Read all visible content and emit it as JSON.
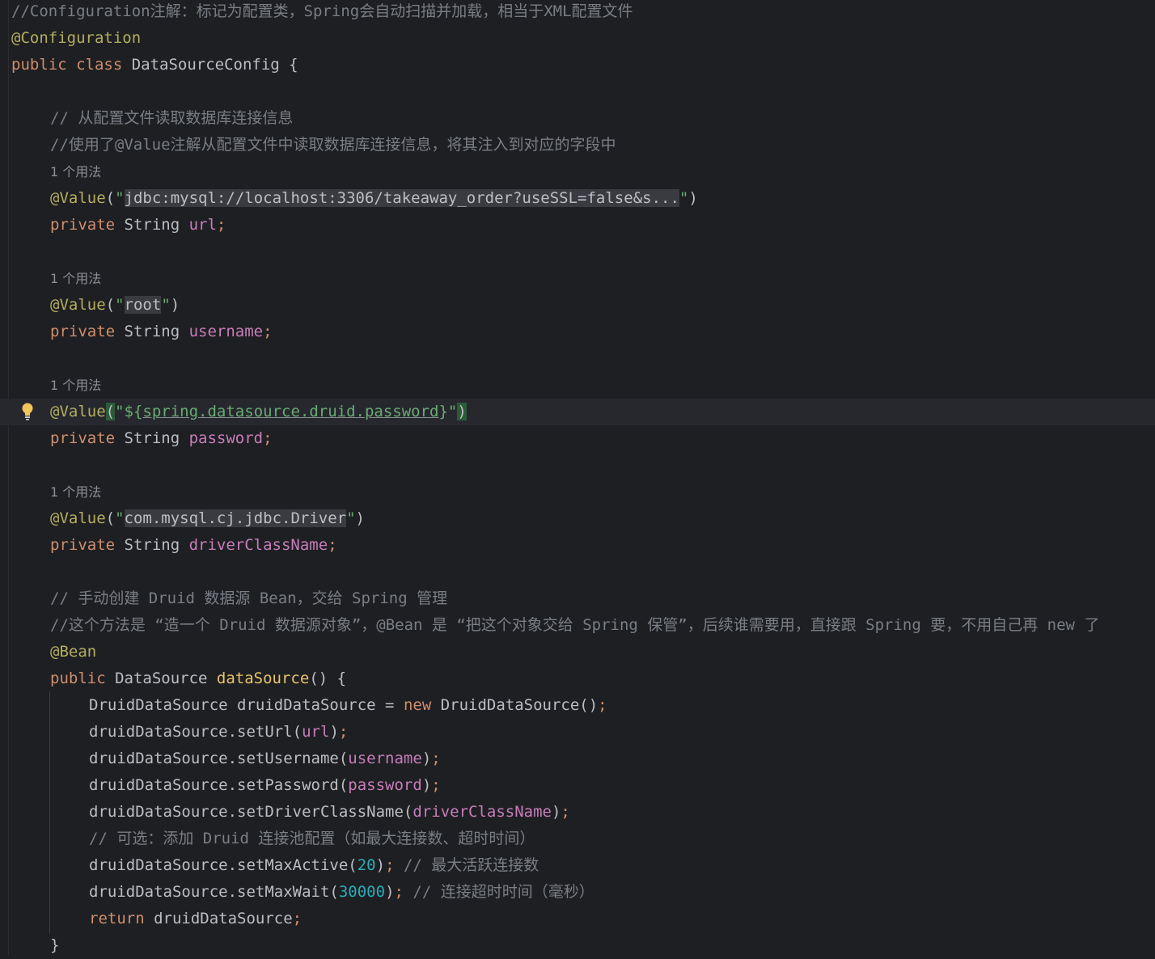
{
  "editor": {
    "lines": [
      {
        "indent": 0,
        "tokens": [
          {
            "t": "//Configuration注解：标记为配置类，Spring会自动扫描并加载，相当于XML配置文件",
            "c": "cmt"
          }
        ]
      },
      {
        "indent": 0,
        "tokens": [
          {
            "t": "@Configuration",
            "c": "ann"
          }
        ]
      },
      {
        "indent": 0,
        "tokens": [
          {
            "t": "public class ",
            "c": "kw"
          },
          {
            "t": "DataSourceConfig {",
            "c": "plain"
          }
        ]
      },
      {
        "indent": 0,
        "tokens": []
      },
      {
        "indent": 1,
        "tokens": [
          {
            "t": "// 从配置文件读取数据库连接信息",
            "c": "cmt"
          }
        ]
      },
      {
        "indent": 1,
        "tokens": [
          {
            "t": "//使用了@Value注解从配置文件中读取数据库连接信息，将其注入到对应的字段中",
            "c": "cmt"
          }
        ]
      },
      {
        "indent": 1,
        "hint": true,
        "tokens": [
          {
            "t": "1 个用法",
            "c": "hint"
          }
        ]
      },
      {
        "indent": 1,
        "tokens": [
          {
            "t": "@Value",
            "c": "ann"
          },
          {
            "t": "(",
            "c": "plain"
          },
          {
            "t": "\"",
            "c": "str"
          },
          {
            "t": "jdbc:mysql://localhost:3306/takeaway_order?useSSL=false&s...",
            "c": "strhl"
          },
          {
            "t": "\"",
            "c": "str"
          },
          {
            "t": ")",
            "c": "plain"
          }
        ]
      },
      {
        "indent": 1,
        "tokens": [
          {
            "t": "private ",
            "c": "kw"
          },
          {
            "t": "String ",
            "c": "plain"
          },
          {
            "t": "url",
            "c": "fld"
          },
          {
            "t": ";",
            "c": "kw"
          }
        ]
      },
      {
        "indent": 0,
        "tokens": []
      },
      {
        "indent": 1,
        "hint": true,
        "tokens": [
          {
            "t": "1 个用法",
            "c": "hint"
          }
        ]
      },
      {
        "indent": 1,
        "tokens": [
          {
            "t": "@Value",
            "c": "ann"
          },
          {
            "t": "(",
            "c": "plain"
          },
          {
            "t": "\"",
            "c": "str"
          },
          {
            "t": "root",
            "c": "strhl"
          },
          {
            "t": "\"",
            "c": "str"
          },
          {
            "t": ")",
            "c": "plain"
          }
        ]
      },
      {
        "indent": 1,
        "tokens": [
          {
            "t": "private ",
            "c": "kw"
          },
          {
            "t": "String ",
            "c": "plain"
          },
          {
            "t": "username",
            "c": "fld"
          },
          {
            "t": ";",
            "c": "kw"
          }
        ]
      },
      {
        "indent": 0,
        "tokens": []
      },
      {
        "indent": 1,
        "hint": true,
        "tokens": [
          {
            "t": "1 个用法",
            "c": "hint"
          }
        ]
      },
      {
        "indent": 1,
        "caret": true,
        "bulb": true,
        "tokens": [
          {
            "t": "@Value",
            "c": "ann"
          },
          {
            "t": "(",
            "c": "brace-hl"
          },
          {
            "t": "\"${",
            "c": "str"
          },
          {
            "t": "spring.datasource.druid.password",
            "c": "placeholder"
          },
          {
            "t": "}\"",
            "c": "str"
          },
          {
            "t": ")",
            "c": "brace-hl"
          }
        ]
      },
      {
        "indent": 1,
        "tokens": [
          {
            "t": "private ",
            "c": "kw"
          },
          {
            "t": "String ",
            "c": "plain"
          },
          {
            "t": "password",
            "c": "fld"
          },
          {
            "t": ";",
            "c": "kw"
          }
        ]
      },
      {
        "indent": 0,
        "tokens": []
      },
      {
        "indent": 1,
        "hint": true,
        "tokens": [
          {
            "t": "1 个用法",
            "c": "hint"
          }
        ]
      },
      {
        "indent": 1,
        "tokens": [
          {
            "t": "@Value",
            "c": "ann"
          },
          {
            "t": "(",
            "c": "plain"
          },
          {
            "t": "\"",
            "c": "str"
          },
          {
            "t": "com.mysql.cj.jdbc.Driver",
            "c": "strhl"
          },
          {
            "t": "\"",
            "c": "str"
          },
          {
            "t": ")",
            "c": "plain"
          }
        ]
      },
      {
        "indent": 1,
        "tokens": [
          {
            "t": "private ",
            "c": "kw"
          },
          {
            "t": "String ",
            "c": "plain"
          },
          {
            "t": "driverClassName",
            "c": "fld"
          },
          {
            "t": ";",
            "c": "kw"
          }
        ]
      },
      {
        "indent": 0,
        "tokens": []
      },
      {
        "indent": 1,
        "tokens": [
          {
            "t": "// 手动创建 Druid 数据源 Bean，交给 Spring 管理",
            "c": "cmt"
          }
        ]
      },
      {
        "indent": 1,
        "tokens": [
          {
            "t": "//这个方法是 “造一个 Druid 数据源对象”，@Bean 是 “把这个对象交给 Spring 保管”，后续谁需要用，直接跟 Spring 要，不用自己再 new 了",
            "c": "cmt"
          }
        ]
      },
      {
        "indent": 1,
        "tokens": [
          {
            "t": "@Bean",
            "c": "ann"
          }
        ]
      },
      {
        "indent": 1,
        "tokens": [
          {
            "t": "public ",
            "c": "kw"
          },
          {
            "t": "DataSource ",
            "c": "plain"
          },
          {
            "t": "dataSource",
            "c": "fn"
          },
          {
            "t": "() {",
            "c": "plain"
          }
        ]
      },
      {
        "indent": 2,
        "tokens": [
          {
            "t": "DruidDataSource druidDataSource = ",
            "c": "plain"
          },
          {
            "t": "new ",
            "c": "kw"
          },
          {
            "t": "DruidDataSource()",
            "c": "plain"
          },
          {
            "t": ";",
            "c": "kw"
          }
        ]
      },
      {
        "indent": 2,
        "tokens": [
          {
            "t": "druidDataSource.setUrl(",
            "c": "plain"
          },
          {
            "t": "url",
            "c": "fld"
          },
          {
            "t": ")",
            "c": "plain"
          },
          {
            "t": ";",
            "c": "kw"
          }
        ]
      },
      {
        "indent": 2,
        "tokens": [
          {
            "t": "druidDataSource.setUsername(",
            "c": "plain"
          },
          {
            "t": "username",
            "c": "fld"
          },
          {
            "t": ")",
            "c": "plain"
          },
          {
            "t": ";",
            "c": "kw"
          }
        ]
      },
      {
        "indent": 2,
        "tokens": [
          {
            "t": "druidDataSource.setPassword(",
            "c": "plain"
          },
          {
            "t": "password",
            "c": "fld"
          },
          {
            "t": ")",
            "c": "plain"
          },
          {
            "t": ";",
            "c": "kw"
          }
        ]
      },
      {
        "indent": 2,
        "tokens": [
          {
            "t": "druidDataSource.setDriverClassName(",
            "c": "plain"
          },
          {
            "t": "driverClassName",
            "c": "fld"
          },
          {
            "t": ")",
            "c": "plain"
          },
          {
            "t": ";",
            "c": "kw"
          }
        ]
      },
      {
        "indent": 2,
        "tokens": [
          {
            "t": "// 可选：添加 Druid 连接池配置（如最大连接数、超时时间）",
            "c": "cmt"
          }
        ]
      },
      {
        "indent": 2,
        "tokens": [
          {
            "t": "druidDataSource.setMaxActive(",
            "c": "plain"
          },
          {
            "t": "20",
            "c": "num"
          },
          {
            "t": ")",
            "c": "plain"
          },
          {
            "t": "; ",
            "c": "kw"
          },
          {
            "t": "// 最大活跃连接数",
            "c": "cmt"
          }
        ]
      },
      {
        "indent": 2,
        "tokens": [
          {
            "t": "druidDataSource.setMaxWait(",
            "c": "plain"
          },
          {
            "t": "30000",
            "c": "num"
          },
          {
            "t": ")",
            "c": "plain"
          },
          {
            "t": "; ",
            "c": "kw"
          },
          {
            "t": "// 连接超时时间（毫秒）",
            "c": "cmt"
          }
        ]
      },
      {
        "indent": 2,
        "tokens": [
          {
            "t": "return ",
            "c": "kw"
          },
          {
            "t": "druidDataSource",
            "c": "plain"
          },
          {
            "t": ";",
            "c": "kw"
          }
        ]
      },
      {
        "indent": 1,
        "tokens": [
          {
            "t": "}",
            "c": "plain"
          }
        ]
      }
    ]
  }
}
